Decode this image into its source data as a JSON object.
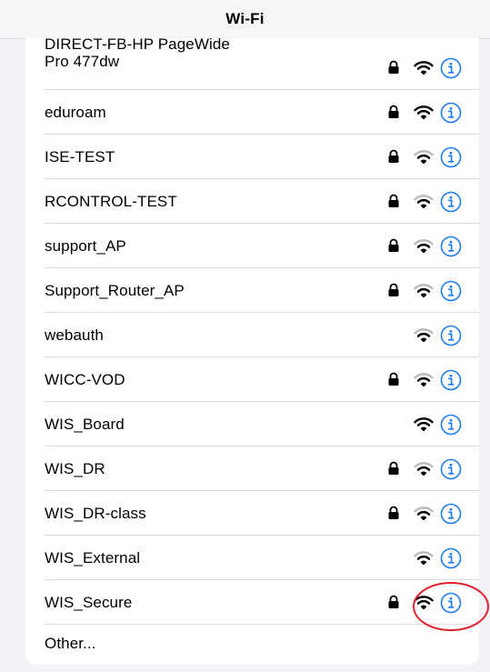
{
  "window": {
    "title": "Wi-Fi"
  },
  "networks": [
    {
      "name": "DIRECT-FB-HP PageWide Pro 477dw",
      "line1": "DIRECT-FB-HP PageWide",
      "line2": "Pro 477dw",
      "secured": true,
      "signal": "strong"
    },
    {
      "name": "eduroam",
      "secured": true,
      "signal": "strong"
    },
    {
      "name": "ISE-TEST",
      "secured": true,
      "signal": "medium"
    },
    {
      "name": "RCONTROL-TEST",
      "secured": true,
      "signal": "medium"
    },
    {
      "name": "support_AP",
      "secured": true,
      "signal": "medium"
    },
    {
      "name": "Support_Router_AP",
      "secured": true,
      "signal": "medium"
    },
    {
      "name": "webauth",
      "secured": false,
      "signal": "medium"
    },
    {
      "name": "WICC-VOD",
      "secured": true,
      "signal": "medium"
    },
    {
      "name": "WIS_Board",
      "secured": false,
      "signal": "strong"
    },
    {
      "name": "WIS_DR",
      "secured": true,
      "signal": "medium"
    },
    {
      "name": "WIS_DR-class",
      "secured": true,
      "signal": "medium"
    },
    {
      "name": "WIS_External",
      "secured": false,
      "signal": "medium"
    },
    {
      "name": "WIS_Secure",
      "secured": true,
      "signal": "strong",
      "annotated": true
    }
  ],
  "other": {
    "label": "Other..."
  },
  "icons": {
    "lock": "lock-icon",
    "wifi": "wifi-icon",
    "info": "info-icon"
  },
  "colors": {
    "accent": "#1a7cf5",
    "wifi_strong": "#000000",
    "wifi_weak": "#b8b8bd",
    "annotation": "#e3212d"
  }
}
